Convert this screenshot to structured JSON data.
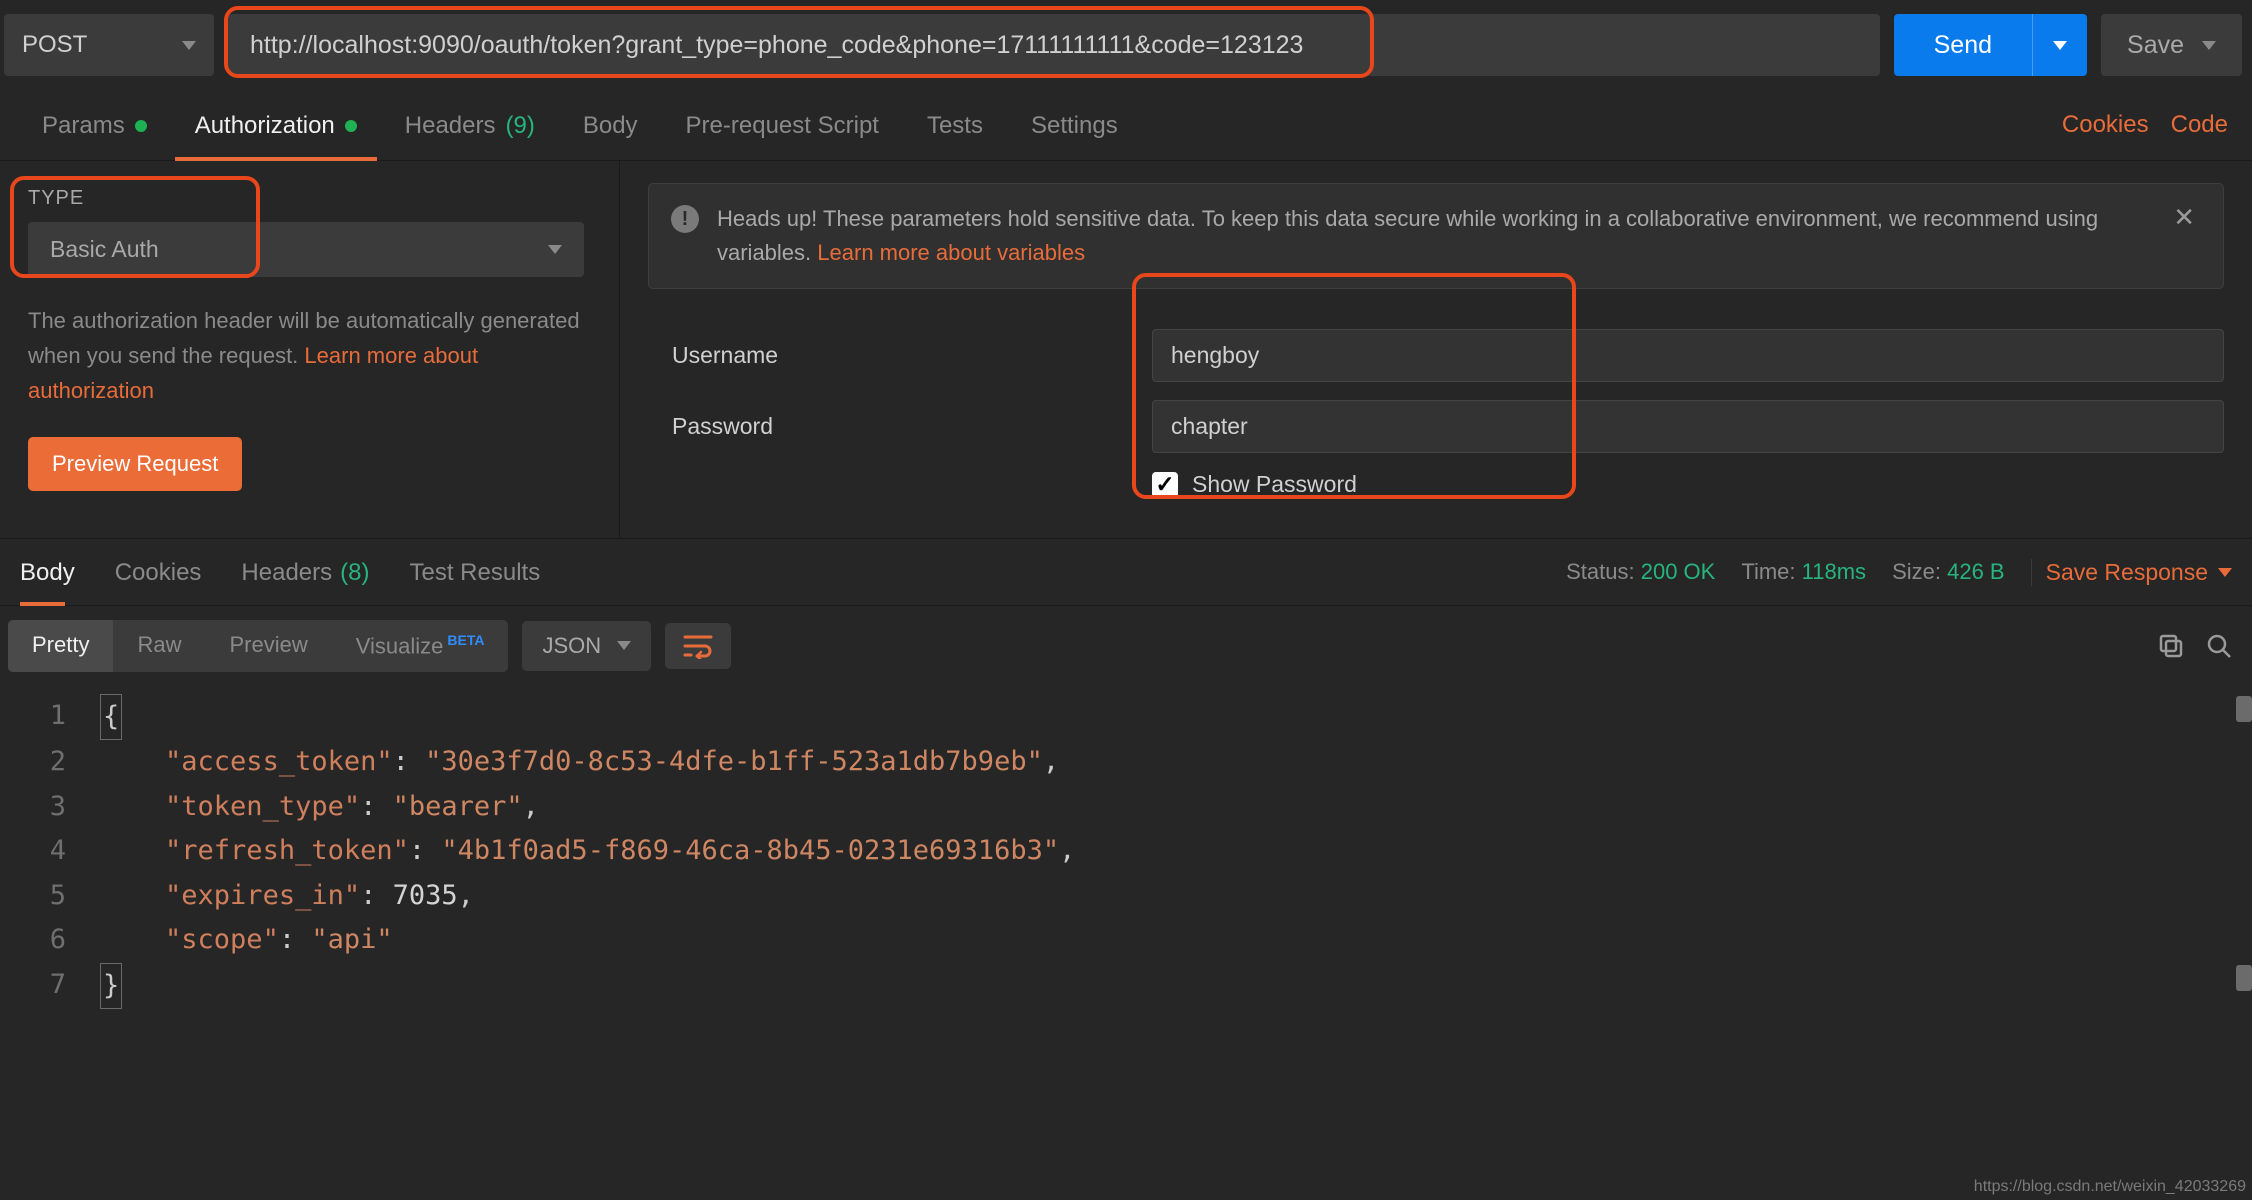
{
  "request": {
    "method": "POST",
    "url": "http://localhost:9090/oauth/token?grant_type=phone_code&phone=17111111111&code=123123",
    "send_label": "Send",
    "save_label": "Save"
  },
  "tabs": {
    "params": "Params",
    "authorization": "Authorization",
    "headers": "Headers",
    "headers_count": "(9)",
    "body": "Body",
    "prereq": "Pre-request Script",
    "tests": "Tests",
    "settings": "Settings",
    "cookies_link": "Cookies",
    "code_link": "Code"
  },
  "auth": {
    "type_label": "TYPE",
    "type_value": "Basic Auth",
    "desc_1": "The authorization header will be automatically generated when you send the request. ",
    "desc_link": "Learn more about authorization",
    "preview_btn": "Preview Request",
    "banner_text": "Heads up! These parameters hold sensitive data. To keep this data secure while working in a collaborative environment, we recommend using variables. ",
    "banner_link": "Learn more about variables",
    "username_label": "Username",
    "username_value": "hengboy",
    "password_label": "Password",
    "password_value": "chapter",
    "show_password": "Show Password"
  },
  "response": {
    "tabs": {
      "body": "Body",
      "cookies": "Cookies",
      "headers": "Headers",
      "headers_count": "(8)",
      "tests": "Test Results"
    },
    "status_label": "Status:",
    "status_value": "200 OK",
    "time_label": "Time:",
    "time_value": "118ms",
    "size_label": "Size:",
    "size_value": "426 B",
    "save_response": "Save Response"
  },
  "body_toolbar": {
    "pretty": "Pretty",
    "raw": "Raw",
    "preview": "Preview",
    "visualize": "Visualize",
    "visualize_badge": "BETA",
    "format": "JSON"
  },
  "json": {
    "access_token_key": "\"access_token\"",
    "access_token_val": "\"30e3f7d0-8c53-4dfe-b1ff-523a1db7b9eb\"",
    "token_type_key": "\"token_type\"",
    "token_type_val": "\"bearer\"",
    "refresh_token_key": "\"refresh_token\"",
    "refresh_token_val": "\"4b1f0ad5-f869-46ca-8b45-0231e69316b3\"",
    "expires_in_key": "\"expires_in\"",
    "expires_in_val": "7035",
    "scope_key": "\"scope\"",
    "scope_val": "\"api\""
  },
  "watermark": "https://blog.csdn.net/weixin_42033269"
}
